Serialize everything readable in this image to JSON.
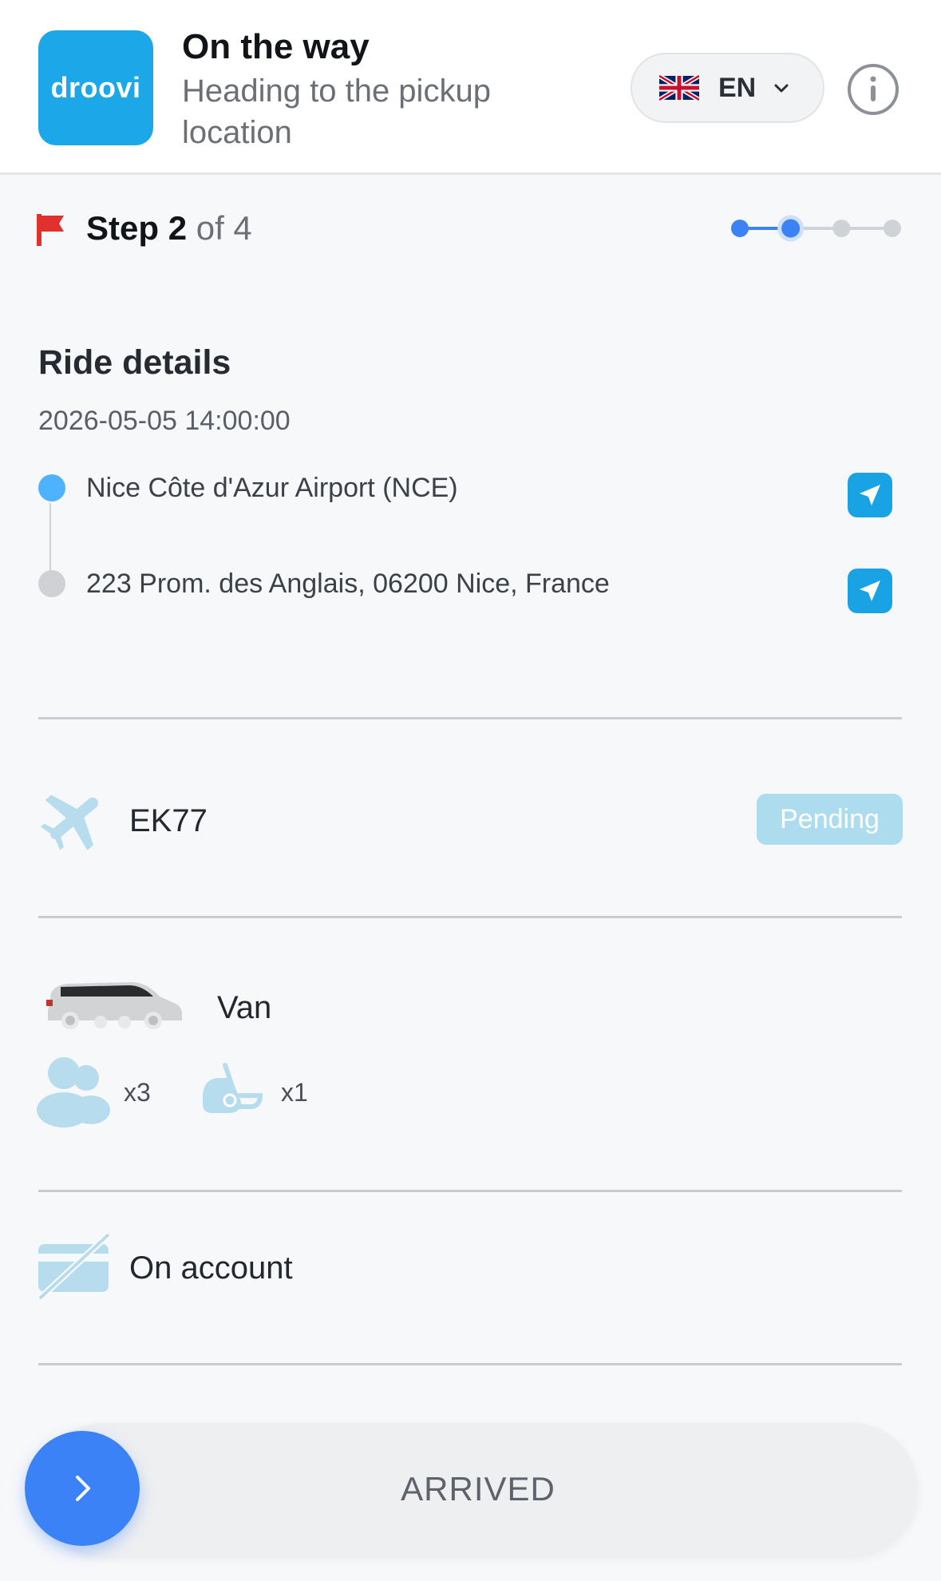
{
  "header": {
    "logo_text": "droovi",
    "title": "On the way",
    "subtitle": "Heading to the pickup location",
    "language": {
      "code": "EN",
      "flag": "uk-flag-icon"
    },
    "info_icon": "info-icon"
  },
  "step": {
    "label": "Step",
    "current": "2",
    "of_text": "of 4",
    "total": 4,
    "current_index": 2,
    "flag_icon": "red-flag-icon",
    "active_color": "#3b82f6",
    "inactive_color": "#cfd3d8"
  },
  "ride": {
    "title": "Ride details",
    "datetime": "2026-05-05 14:00:00",
    "pickup": "Nice Côte d'Azur Airport (NCE)",
    "dropoff": "223 Prom. des Anglais, 06200 Nice, France"
  },
  "flight": {
    "number": "EK77",
    "status": "Pending",
    "icon": "airplane-icon"
  },
  "vehicle": {
    "type": "Van",
    "passengers": "x3",
    "child_seats": "x1",
    "icons": [
      "van-icon",
      "passengers-icon",
      "child-seat-icon"
    ]
  },
  "payment": {
    "method": "On account",
    "icon": "no-card-icon"
  },
  "action": {
    "label": "ARRIVED",
    "icon": "chevron-right-icon"
  },
  "colors": {
    "brand": "#1ba7e8",
    "accent": "#3b82f6",
    "icon_light": "#b6dced",
    "badge_bg": "#aedcef"
  }
}
